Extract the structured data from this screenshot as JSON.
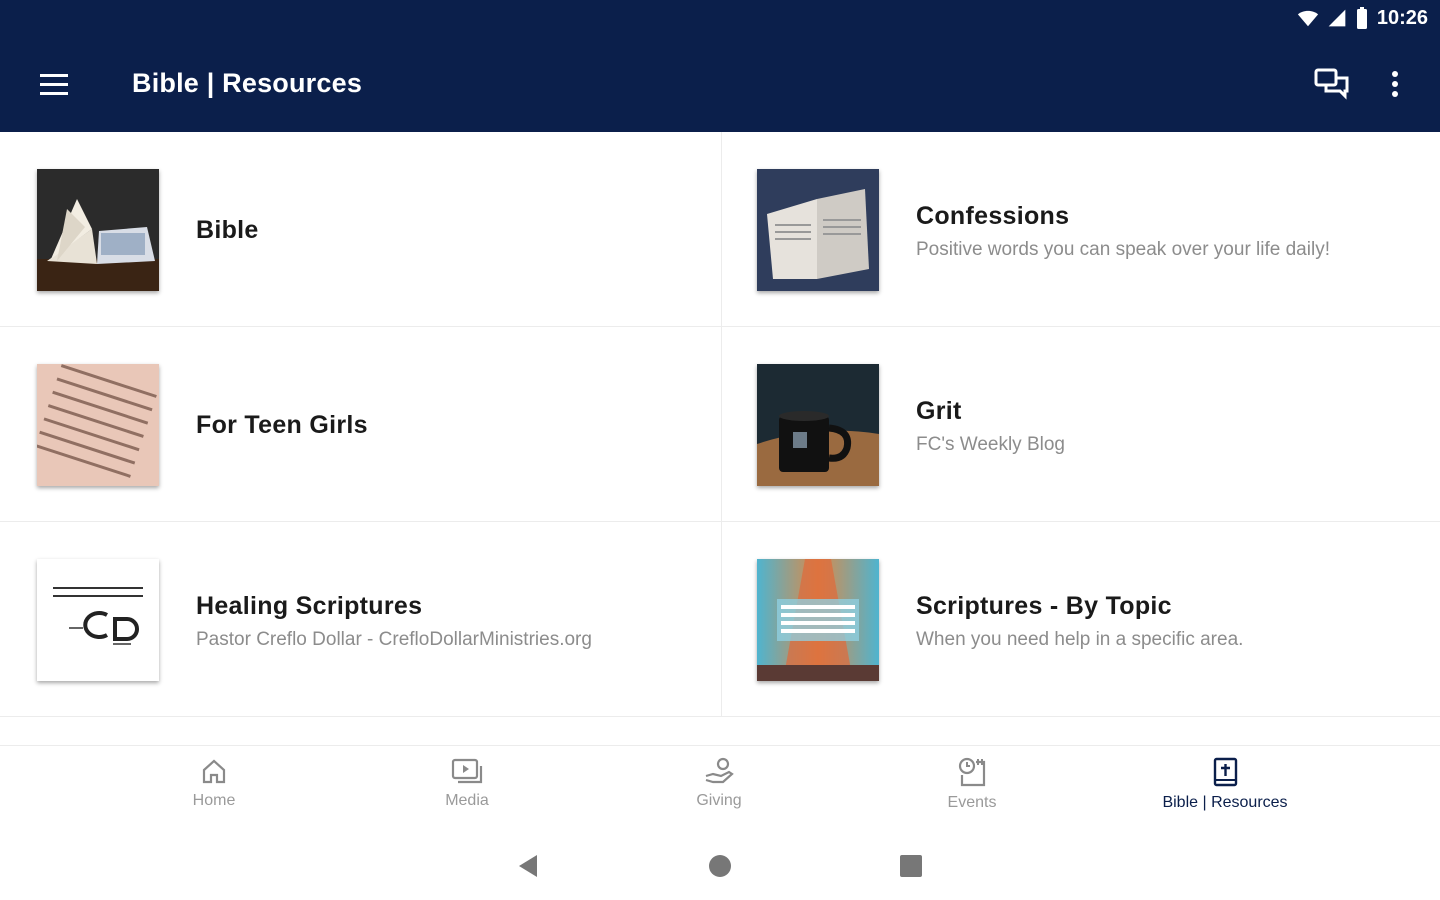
{
  "status": {
    "time": "10:26",
    "wifi_icon": "wifi-icon",
    "signal_icon": "signal-icon",
    "battery_icon": "battery-icon"
  },
  "app_bar": {
    "title": "Bible | Resources",
    "background": "#0b1f4b"
  },
  "items": [
    {
      "title": "Bible",
      "subtitle": ""
    },
    {
      "title": "Confessions",
      "subtitle": "Positive words you can speak over your life daily!"
    },
    {
      "title": "For Teen Girls",
      "subtitle": ""
    },
    {
      "title": "Grit",
      "subtitle": "FC's Weekly Blog"
    },
    {
      "title": "Healing Scriptures",
      "subtitle": "Pastor Creflo Dollar - CrefloDollarMinistries.org"
    },
    {
      "title": "Scriptures - By Topic",
      "subtitle": "When you need help in a specific area."
    }
  ],
  "bottom_nav": [
    {
      "label": "Home",
      "icon": "home-icon"
    },
    {
      "label": "Media",
      "icon": "media-icon"
    },
    {
      "label": "Giving",
      "icon": "giving-icon"
    },
    {
      "label": "Events",
      "icon": "events-icon"
    },
    {
      "label": "Bible | Resources",
      "icon": "bible-icon",
      "active": true
    }
  ],
  "colors": {
    "primary": "#0b1f4b",
    "muted_text": "#8c8c8c"
  }
}
